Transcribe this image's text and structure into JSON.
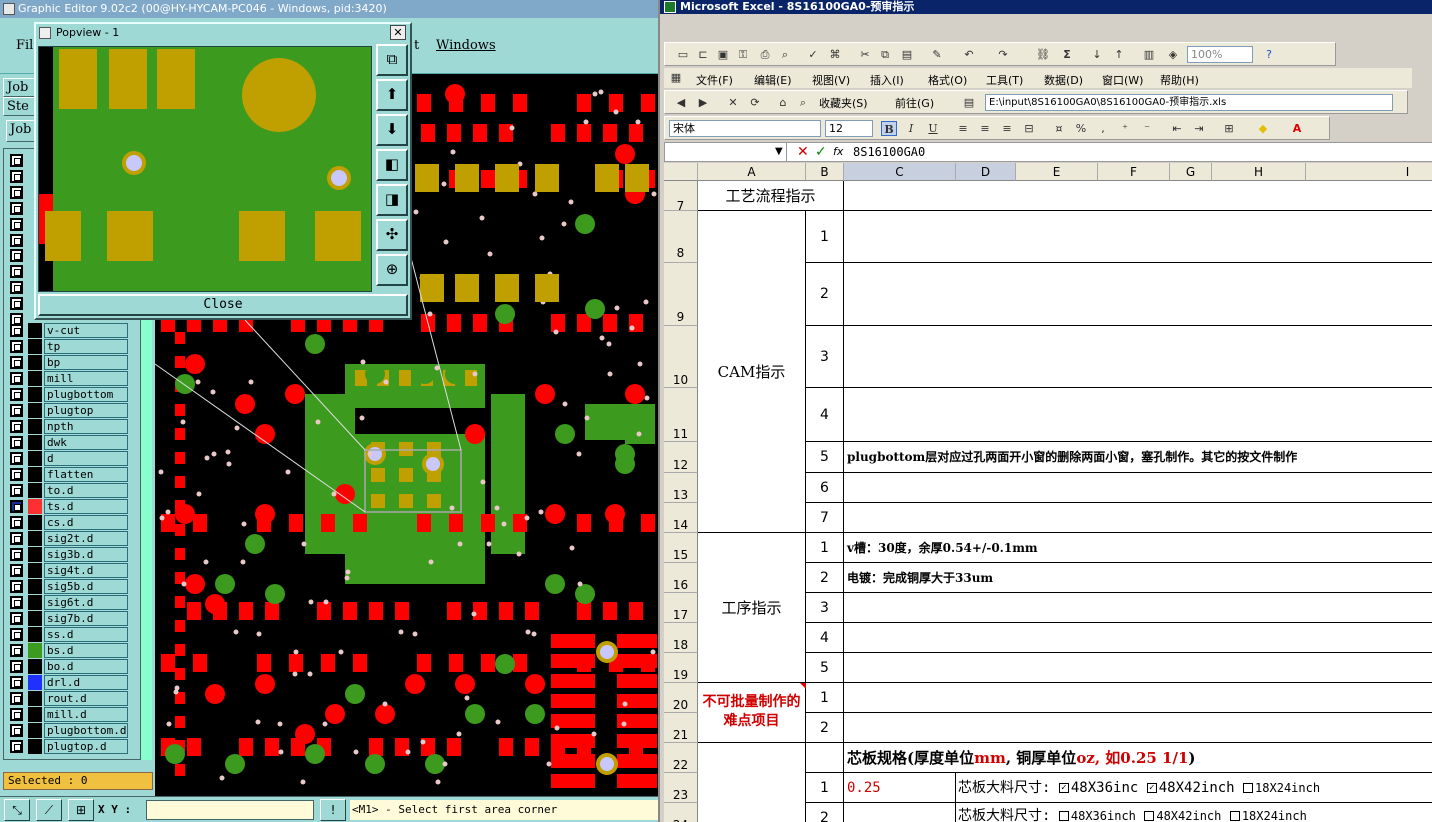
{
  "graphic_editor": {
    "title": "Graphic Editor 9.02c2 (00@HY-HYCAM-PC046 - Windows, pid:3420)",
    "menus": {
      "file": "Fil",
      "edit_tail": "t",
      "windows": "Windows"
    },
    "side_buttons": [
      "Job",
      "Ste",
      "Job"
    ],
    "layers": [
      {
        "name": "v-cut"
      },
      {
        "name": "tp"
      },
      {
        "name": "bp"
      },
      {
        "name": "mill"
      },
      {
        "name": "plugbottom"
      },
      {
        "name": "plugtop"
      },
      {
        "name": "npth"
      },
      {
        "name": "dwk"
      },
      {
        "name": "d"
      },
      {
        "name": "flatten"
      },
      {
        "name": "to.d"
      },
      {
        "name": "ts.d"
      },
      {
        "name": "cs.d"
      },
      {
        "name": "sig2t.d"
      },
      {
        "name": "sig3b.d"
      },
      {
        "name": "sig4t.d"
      },
      {
        "name": "sig5b.d"
      },
      {
        "name": "sig6t.d"
      },
      {
        "name": "sig7b.d"
      },
      {
        "name": "ss.d"
      },
      {
        "name": "bs.d"
      },
      {
        "name": "bo.d"
      },
      {
        "name": "drl.d"
      },
      {
        "name": "rout.d"
      },
      {
        "name": "mill.d"
      },
      {
        "name": "plugbottom.d"
      },
      {
        "name": "plugtop.d"
      }
    ],
    "selected_label": "Selected : 0",
    "xy_label": "X Y :",
    "prompt": "<M1> - Select first area corner",
    "colors": {
      "copper": "#c0a000",
      "pad": "#ff0000",
      "green": "#3c9a1e",
      "drill": "#c8c8ff"
    }
  },
  "popview": {
    "title": "Popview - 1",
    "close_label": "Close",
    "tool_icons": [
      "fit-window-icon",
      "zoom-in-icon",
      "zoom-out-icon",
      "pan-left-icon",
      "pan-right-icon",
      "fit-all-icon",
      "center-icon"
    ]
  },
  "excel": {
    "title": "Microsoft Excel - 8S16100GA0-预审指示",
    "zoom": "100%",
    "menu": [
      "文件(F)",
      "编辑(E)",
      "视图(V)",
      "插入(I)",
      "格式(O)",
      "工具(T)",
      "数据(D)",
      "窗口(W)",
      "帮助(H)"
    ],
    "web_toolbar": {
      "favorites": "收藏夹(S)",
      "go": "前往(G)",
      "path": "E:\\input\\8S16100GA0\\8S16100GA0-预审指示.xls"
    },
    "font_name": "宋体",
    "font_size": "12",
    "formula_value": "8S16100GA0",
    "fx_label": "fx",
    "columns": [
      "A",
      "B",
      "C",
      "D",
      "E",
      "F",
      "G",
      "H",
      "I"
    ],
    "rows": [
      "7",
      "8",
      "9",
      "10",
      "11",
      "12",
      "13",
      "14",
      "15",
      "16",
      "17",
      "18",
      "19",
      "20",
      "21",
      "22",
      "23",
      "24"
    ],
    "section_process": "工艺流程指示",
    "section_cam": "CAM指示",
    "section_procedure": "工序指示",
    "section_difficult": "不可批量制作的难点项目",
    "cam_numbers": [
      "1",
      "2",
      "3",
      "4",
      "5",
      "6",
      "7"
    ],
    "cam_row5_text": "plugbottom层对应过孔两面开小窗的删除两面小窗，塞孔制作。其它的按文件制作",
    "proc_numbers": [
      "1",
      "2",
      "3",
      "4",
      "5"
    ],
    "proc_row1_text": "v槽：30度，余厚0.54+/-0.1mm",
    "proc_row2_text": "电镀：完成铜厚大于33um",
    "diff_numbers": [
      "1",
      "2"
    ],
    "core_spec": {
      "prefix": "芯板规格(厚度单位",
      "unit1": "mm",
      "mid": ", 铜厚单位",
      "unit2": "oz, 如0.25 1/1",
      "suffix": ")"
    },
    "core_row1": {
      "num": "1",
      "thickness": "0.25",
      "label": "芯板大料尺寸:",
      "opt1": "48X36inc",
      "opt2": "48X42inch",
      "opt3": "18X24inch"
    },
    "core_row2": {
      "num": "2",
      "label": "芯板大料尺寸:",
      "opt1": "48X36inch",
      "opt2": "48X42inch",
      "opt3": "18X24inch"
    },
    "colors": {
      "accent_red": "#d00000"
    }
  }
}
